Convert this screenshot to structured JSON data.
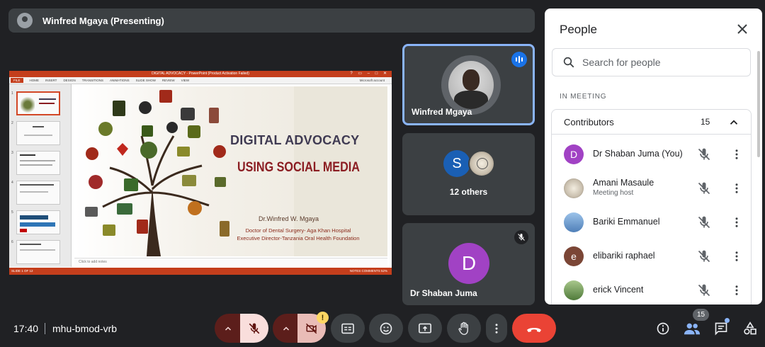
{
  "presenter": {
    "name": "Winfred Mgaya (Presenting)"
  },
  "slide": {
    "app_title": "DIGITAL ADVOCACY - PowerPoint (Product Activation Failed)",
    "ribbon_tabs": [
      "FILE",
      "HOME",
      "INSERT",
      "DESIGN",
      "TRANSITIONS",
      "ANIMATIONS",
      "SLIDE SHOW",
      "REVIEW",
      "VIEW"
    ],
    "account": "Microsoft account",
    "thumb_numbers": [
      "1",
      "2",
      "3",
      "4",
      "5",
      "6"
    ],
    "title_line1": "DIGITAL ADVOCACY",
    "title_line2": "USING SOCIAL MEDIA",
    "author": "Dr.Winfred W. Mgaya",
    "description": "Doctor of Dental Surgery- Aga Khan Hospital Executive Director-Tanzania Oral Health Foundation",
    "notes_placeholder": "Click to add notes",
    "status_left": "SLIDE 1 OF 12",
    "status_right": "NOTES   COMMENTS   52%"
  },
  "tiles": [
    {
      "name": "Winfred Mgaya"
    },
    {
      "name": "12 others",
      "initial": "S"
    },
    {
      "name": "Dr Shaban Juma",
      "initial": "D"
    }
  ],
  "people_panel": {
    "title": "People",
    "search_placeholder": "Search for people",
    "section": "IN MEETING",
    "group_label": "Contributors",
    "group_count": "15",
    "participants": [
      {
        "name": "Dr Shaban Juma (You)",
        "initial": "D",
        "color": "#a142c4"
      },
      {
        "name": "Amani Masaule",
        "role": "Meeting host",
        "initial": "",
        "color": "#cfc6b4"
      },
      {
        "name": "Bariki Emmanuel",
        "initial": "",
        "color": "#7da6d8"
      },
      {
        "name": "elibariki raphael",
        "initial": "e",
        "color": "#7b4636"
      },
      {
        "name": "erick Vincent",
        "initial": "",
        "color": "#6f9a5a"
      }
    ]
  },
  "bottom_bar": {
    "time": "17:40",
    "meeting_code": "mhu-bmod-vrb",
    "warning_badge": "!",
    "people_count": "15"
  },
  "colors": {
    "background": "#202124",
    "tile": "#3c4043",
    "accent_blue": "#8ab4f8",
    "hangup_red": "#ea4335"
  }
}
